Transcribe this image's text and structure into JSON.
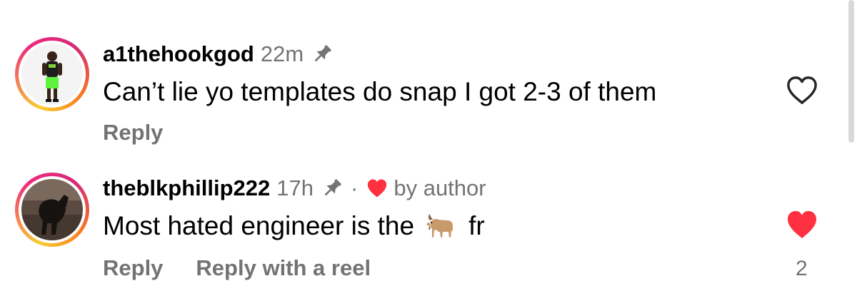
{
  "comments": [
    {
      "username": "a1thehookgod",
      "time": "22m",
      "pinned": true,
      "text": "Can’t lie yo templates do snap I got 2-3 of them",
      "actions": [
        "Reply"
      ],
      "liked": false
    },
    {
      "username": "theblkphillip222",
      "time": "17h",
      "pinned": true,
      "separator": "·",
      "author_badge": "by author",
      "text_before": "Most hated engineer is the",
      "emoji": "goat-emoji",
      "text_after": "fr",
      "actions": [
        "Reply",
        "Reply with a reel"
      ],
      "liked": true,
      "like_count": "2"
    }
  ],
  "colors": {
    "secondary_text": "#737373",
    "like_red": "#ff3040",
    "outline_heart": "#262626"
  }
}
